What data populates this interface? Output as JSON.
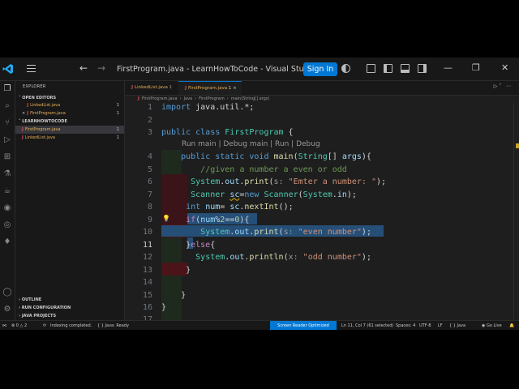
{
  "window": {
    "title": "FirstProgram.java - LearnHowToCode - Visual Studio Code",
    "sign_in": "Sign In"
  },
  "sidebar": {
    "title": "EXPLORER",
    "open_editors_label": "OPEN EDITORS",
    "open_editors": [
      {
        "name": "LinkedList.java",
        "count": "1"
      },
      {
        "name": "FirstProgram.java",
        "count": "1"
      }
    ],
    "project_label": "LEARNHOWTOCODE",
    "project_files": [
      {
        "name": "FirstProgram.java",
        "count": "1"
      },
      {
        "name": "LinkedList.java",
        "count": "1"
      }
    ],
    "bottom_sections": [
      "OUTLINE",
      "RUN CONFIGURATION",
      "JAVA PROJECTS"
    ]
  },
  "tabs": [
    {
      "name": "LinkedList.java",
      "count": "1"
    },
    {
      "name": "FirstProgram.java",
      "count": "1"
    }
  ],
  "breadcrumb": [
    "FirstProgram.java",
    "Java",
    "FirstProgram",
    "main(String[] args)"
  ],
  "editor": {
    "line_numbers": [
      "1",
      "2",
      "3",
      "",
      "4",
      "5",
      "6",
      "7",
      "8",
      "9",
      "10",
      "11",
      "12",
      "13",
      "14",
      "15",
      "16",
      "17"
    ],
    "codelens": "Run main | Debug main | Run | Debug",
    "current_line": "11"
  },
  "status": {
    "problems": "0 △ 2",
    "indexing": "Indexing completed.",
    "java_ready": "Java: Ready",
    "screen_reader": "Screen Reader Optimized",
    "cursor": "Ln 11, Col 7 (61 selected)",
    "spaces": "Spaces: 4",
    "encoding": "UTF-8",
    "eol": "LF",
    "language": "Java",
    "golive": "Go Live"
  }
}
